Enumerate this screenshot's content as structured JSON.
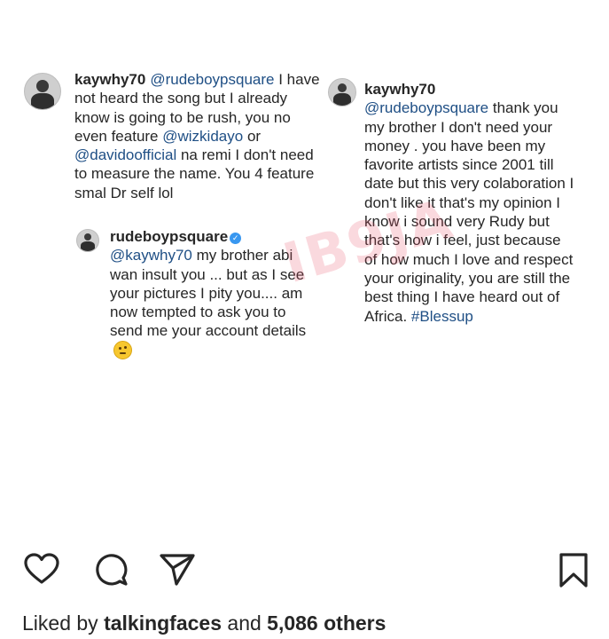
{
  "watermark": "IB9JA",
  "left_comment": {
    "username": "kaywhy70",
    "mention1": "@rudeboypsquare",
    "text1": "I have not heard the song but I already know is going to be rush, you no even feature",
    "mention2": "@wizkidayo",
    "text2": "or",
    "mention3": "@davidoofficial",
    "text3": "na remi I don't need to measure the name. You 4 feature smal Dr self lol"
  },
  "reply": {
    "username": "rudeboypsquare",
    "mention": "@kaywhy70",
    "text": "my brother abi wan insult you ... but as I see your pictures I pity you.... am now tempted to ask you to send me your account details"
  },
  "right_comment": {
    "username": "kaywhy70",
    "mention": "@rudeboypsquare",
    "text": "thank you my brother I don't need your money . you have been my favorite artists since 2001 till date but this very colaboration I don't like it that's my opinion I know i sound very Rudy but that's how i feel, just because of how much I love and respect your originality, you are still the best thing I have heard out of Africa.",
    "hashtag": "#Blessup"
  },
  "likes": {
    "prefix": "Liked by",
    "user": "talkingfaces",
    "middle": "and",
    "count": "5,086 others"
  },
  "icons": [
    "heart-icon",
    "comment-icon",
    "share-icon",
    "bookmark-icon"
  ]
}
